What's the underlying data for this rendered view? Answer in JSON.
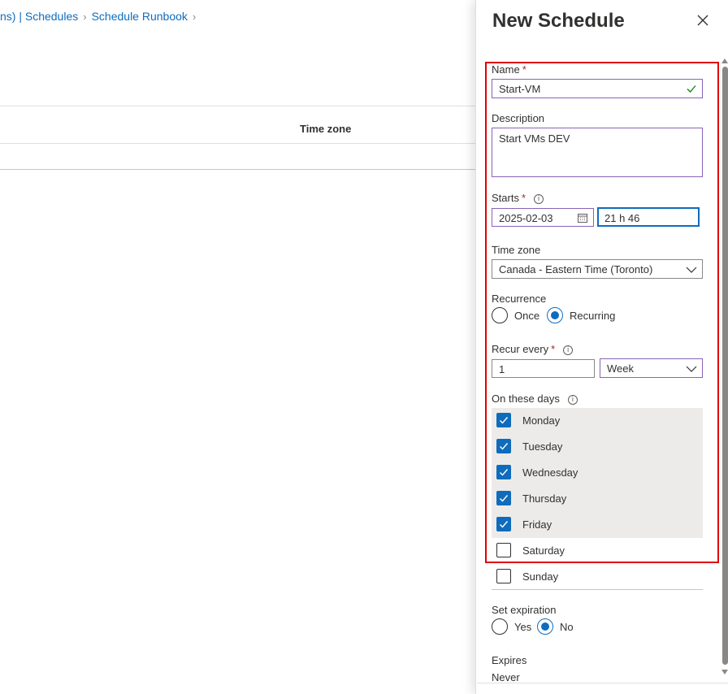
{
  "breadcrumb": {
    "partial": "ns) | Schedules",
    "current": "Schedule Runbook"
  },
  "table": {
    "column_timezone": "Time zone"
  },
  "panel": {
    "title": "New Schedule",
    "name_label": "Name",
    "name_value": "Start-VM",
    "description_label": "Description",
    "description_value": "Start VMs DEV",
    "starts_label": "Starts",
    "starts_date": "2025-02-03",
    "starts_time": "21 h 46",
    "timezone_label": "Time zone",
    "timezone_value": "Canada - Eastern Time (Toronto)",
    "recurrence_label": "Recurrence",
    "recurrence_once": "Once",
    "recurrence_recurring": "Recurring",
    "recurrence_selected": "Recurring",
    "recur_every_label": "Recur every",
    "recur_every_value": "1",
    "recur_unit": "Week",
    "days_label": "On these days",
    "days": [
      {
        "label": "Monday",
        "checked": true
      },
      {
        "label": "Tuesday",
        "checked": true
      },
      {
        "label": "Wednesday",
        "checked": true
      },
      {
        "label": "Thursday",
        "checked": true
      },
      {
        "label": "Friday",
        "checked": true
      },
      {
        "label": "Saturday",
        "checked": false
      },
      {
        "label": "Sunday",
        "checked": false
      }
    ],
    "expiration_label": "Set expiration",
    "expiration_yes": "Yes",
    "expiration_no": "No",
    "expiration_selected": "No",
    "expires_label": "Expires",
    "expires_value": "Never",
    "required_mark": "*",
    "info_glyph": "i"
  },
  "colors": {
    "accent": "#0f6cbd",
    "highlight": "#e00000",
    "required": "#a4262c",
    "valid_check": "#107c10"
  }
}
